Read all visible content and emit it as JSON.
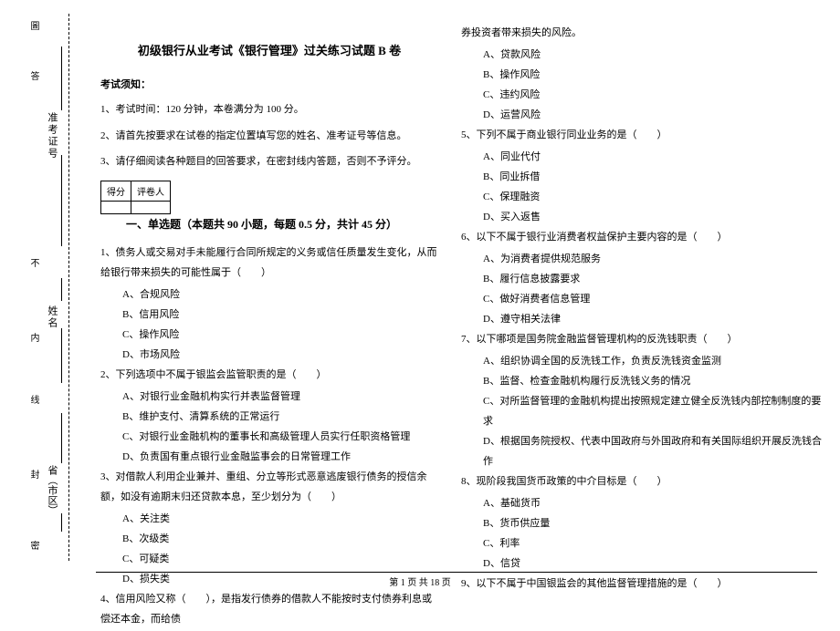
{
  "side": {
    "marks": [
      "圖",
      "答",
      "不",
      "内",
      "线",
      "封",
      "密"
    ],
    "admit_label": "准考证号",
    "name_label": "姓名",
    "province_label": "省（市区）"
  },
  "title": "初级银行从业考试《银行管理》过关练习试题 B 卷",
  "notice": {
    "head": "考试须知：",
    "line1": "1、考试时间：120 分钟，本卷满分为 100 分。",
    "line2": "2、请首先按要求在试卷的指定位置填写您的姓名、准考证号等信息。",
    "line3": "3、请仔细阅读各种题目的回答要求，在密封线内答题，否则不予评分。"
  },
  "score_table": {
    "c1": "得分",
    "c2": "评卷人"
  },
  "section1": "一、单选题（本题共 90 小题，每题 0.5 分，共计 45 分）",
  "q1": {
    "text": "1、债务人或交易对手未能履行合同所规定的义务或信任质量发生变化，从而给银行带来损失的可能性属于（　　）",
    "a": "A、合规风险",
    "b": "B、信用风险",
    "c": "C、操作风险",
    "d": "D、市场风险"
  },
  "q2": {
    "text": "2、下列选项中不属于银监会监管职责的是（　　）",
    "a": "A、对银行业金融机构实行并表监督管理",
    "b": "B、维护支付、清算系统的正常运行",
    "c": "C、对银行业金融机构的董事长和高级管理人员实行任职资格管理",
    "d": "D、负责国有重点银行业金融监事会的日常管理工作"
  },
  "q3": {
    "text": "3、对借款人利用企业兼并、重组、分立等形式恶意逃废银行债务的授信余额，如没有逾期末归还贷款本息，至少划分为（　　）",
    "a": "A、关注类",
    "b": "B、次级类",
    "c": "C、可疑类",
    "d": "D、损失类"
  },
  "q4": {
    "text": "4、信用风险又称（　　），是指发行债券的借款人不能按时支付债券利息或偿还本金，而给债"
  },
  "q4cont": "券投资者带来损失的风险。",
  "q4opts": {
    "a": "A、贷款风险",
    "b": "B、操作风险",
    "c": "C、违约风险",
    "d": "D、运营风险"
  },
  "q5": {
    "text": "5、下列不属于商业银行同业业务的是（　　）",
    "a": "A、同业代付",
    "b": "B、同业拆借",
    "c": "C、保理融资",
    "d": "D、买入返售"
  },
  "q6": {
    "text": "6、以下不属于银行业消费者权益保护主要内容的是（　　）",
    "a": "A、为消费者提供规范服务",
    "b": "B、履行信息披露要求",
    "c": "C、做好消费者信息管理",
    "d": "D、遵守相关法律"
  },
  "q7": {
    "text": "7、以下哪项是国务院金融监督管理机构的反洗钱职责（　　）",
    "a": "A、组织协调全国的反洗钱工作，负责反洗钱资金监测",
    "b": "B、监督、检查金融机构履行反洗钱义务的情况",
    "c": "C、对所监督管理的金融机构提出按照规定建立健全反洗钱内部控制制度的要求",
    "d": "D、根据国务院授权、代表中国政府与外国政府和有关国际组织开展反洗钱合作"
  },
  "q8": {
    "text": "8、现阶段我国货币政策的中介目标是（　　）",
    "a": "A、基础货币",
    "b": "B、货币供应量",
    "c": "C、利率",
    "d": "D、信贷"
  },
  "q9": {
    "text": "9、以下不属于中国银监会的其他监督管理措施的是（　　）"
  },
  "footer": "第 1 页 共 18 页"
}
